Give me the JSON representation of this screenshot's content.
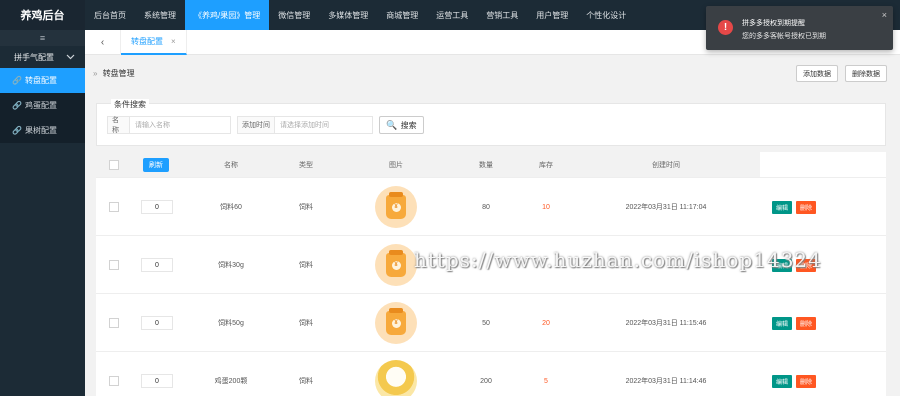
{
  "app": {
    "brand": "养鸡后台"
  },
  "topnav": [
    {
      "label": "后台首页",
      "active": false
    },
    {
      "label": "系统管理",
      "active": false
    },
    {
      "label": "《养鸡/果园》管理",
      "active": true
    },
    {
      "label": "微信管理",
      "active": false
    },
    {
      "label": "多媒体管理",
      "active": false
    },
    {
      "label": "商城管理",
      "active": false
    },
    {
      "label": "运营工具",
      "active": false
    },
    {
      "label": "营销工具",
      "active": false
    },
    {
      "label": "用户管理",
      "active": false
    },
    {
      "label": "个性化设计",
      "active": false
    }
  ],
  "sidebar": {
    "toggle_icon": "≡",
    "group": {
      "label": "拼手气配置",
      "icon": "chevron-down-icon"
    },
    "items": [
      {
        "label": "转盘配置",
        "active": true,
        "icon": "link-icon"
      },
      {
        "label": "鸡蛋配置",
        "active": false,
        "icon": "link-icon"
      },
      {
        "label": "果树配置",
        "active": false,
        "icon": "link-icon"
      }
    ]
  },
  "tabbar": {
    "back": "‹",
    "tab_label": "转盘配置",
    "tab_close": "×"
  },
  "page": {
    "breadcrumb_icon": "»",
    "title": "转盘管理",
    "add_button": "添加数据",
    "delete_button": "删除数据"
  },
  "search": {
    "legend": "条件搜索",
    "name_label": "名称",
    "name_placeholder": "请输入名称",
    "time_label": "添加时间",
    "time_placeholder": "请选择添加时间",
    "search_button": "搜索"
  },
  "table": {
    "header_button": "刷新",
    "columns": [
      "名称",
      "类型",
      "图片",
      "数量",
      "库存",
      "创建时间"
    ],
    "rows": [
      {
        "sort": "0",
        "name": "饲料60",
        "type": "饲料",
        "thumb": "feed-bag",
        "amount": "80",
        "stock": "10",
        "time": "2022年03月31日 11:17:04"
      },
      {
        "sort": "0",
        "name": "饲料30g",
        "type": "饲料",
        "thumb": "feed-bag",
        "amount": "",
        "stock": "",
        "time": ""
      },
      {
        "sort": "0",
        "name": "饲料50g",
        "type": "饲料",
        "thumb": "feed-bag",
        "amount": "50",
        "stock": "20",
        "time": "2022年03月31日 11:15:46"
      },
      {
        "sort": "0",
        "name": "鸡蛋200颗",
        "type": "饲料",
        "thumb": "egg",
        "amount": "200",
        "stock": "5",
        "time": "2022年03月31日 11:14:46"
      }
    ],
    "edit_label": "编辑",
    "delete_label": "删除"
  },
  "watermark": "https://www.huzhan.com/ishop14324",
  "notification": {
    "icon": "!",
    "title": "拼多多授权到期提醒",
    "message": "您的多多客帐号授权已到期",
    "close": "×"
  },
  "colors": {
    "primary": "#1e9fff",
    "dark": "#1c2b36",
    "edit": "#009688",
    "danger": "#ff5722"
  }
}
